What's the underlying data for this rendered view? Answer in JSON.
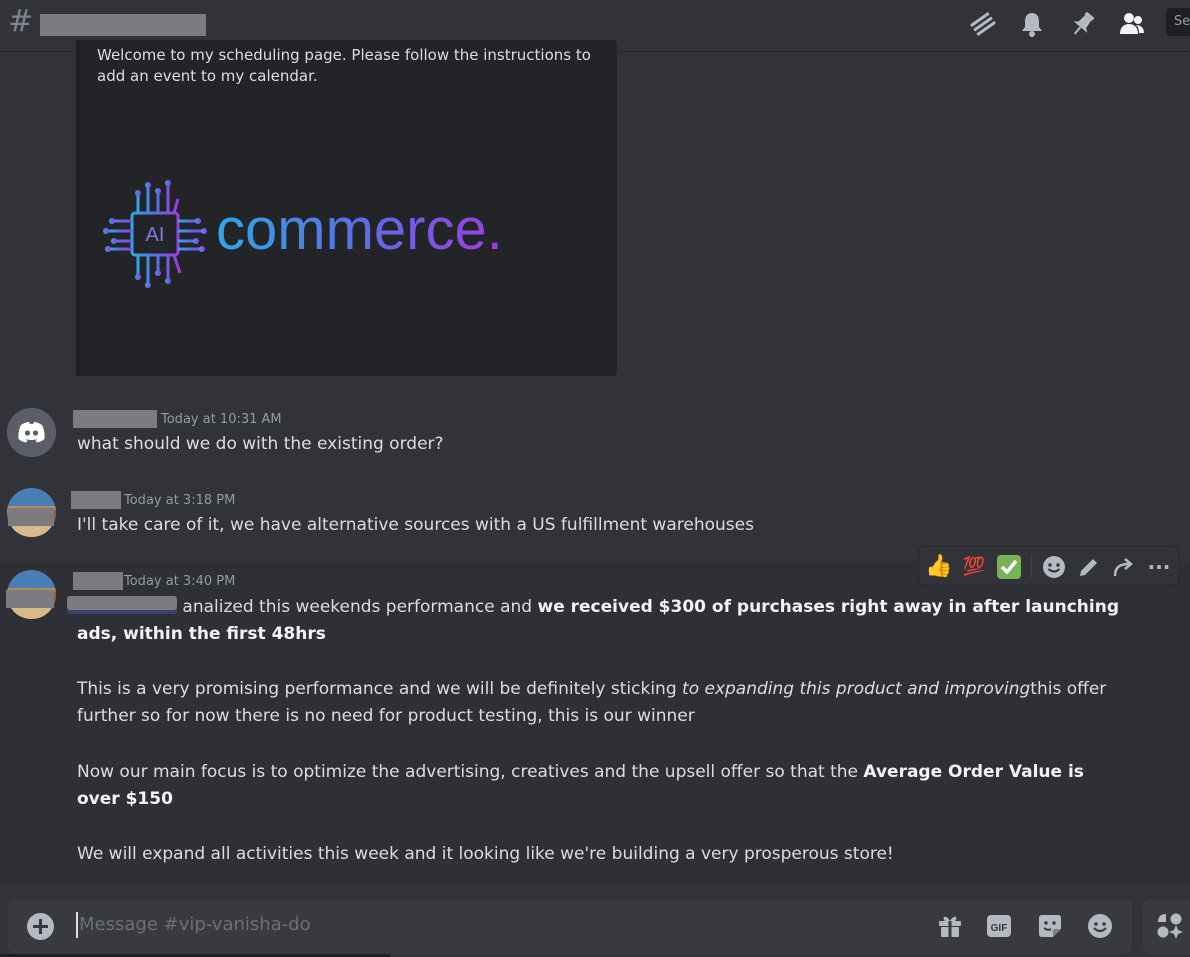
{
  "header": {
    "channel_hash": "#",
    "search_stub": "Se",
    "icons": [
      "threads-icon",
      "bell-icon",
      "pin-icon",
      "members-icon"
    ]
  },
  "embed": {
    "description": "Welcome to my scheduling page. Please follow the instructions to add an event to my calendar.",
    "logo": {
      "chip_label": "AI",
      "wordmark": "commerce."
    }
  },
  "messages": [
    {
      "time": "Today at 10:31 AM",
      "avatar": "discord-logo",
      "text": "what should we do with the existing order?"
    },
    {
      "time": "Today at 3:18 PM",
      "avatar": "landscape-photo",
      "text": "I'll take care of it, we have alternative sources with a US fulfillment warehouses"
    },
    {
      "time": "Today at 3:40 PM",
      "avatar": "landscape-photo",
      "p1_plain": " analized this weekends performance and ",
      "p1_bold": "we received $300 of purchases right away in after launching ads, within the first 48hrs",
      "p2_plain": "This is a very promising performance and we will be definitely sticking ",
      "p2_italic": "to expanding this product and improving",
      "p2_rest": "this offer further so for now there is no need for product testing, this is our winner",
      "p3_plain": "Now our main focus is to optimize the advertising, creatives and the upsell offer so that the ",
      "p3_bold": "Average Order Value is over $150",
      "p4": "We will expand all activities this week and it looking like we're building a very prosperous store!"
    }
  ],
  "hover_toolbar": {
    "reactions": [
      "👍",
      "💯",
      "✅"
    ],
    "actions": [
      "add-reaction-icon",
      "edit-icon",
      "forward-icon",
      "more-icon"
    ],
    "more_label": "···"
  },
  "composer": {
    "placeholder": "Message #vip-vanisha-do",
    "icons": [
      "gift-icon",
      "gif-icon",
      "sticker-icon",
      "emoji-icon",
      "apps-icon"
    ],
    "gif_label": "GIF"
  },
  "colors": {
    "background": "#313338",
    "embed_bg": "#232428",
    "text": "#dbdee1",
    "muted": "#949ba4"
  }
}
